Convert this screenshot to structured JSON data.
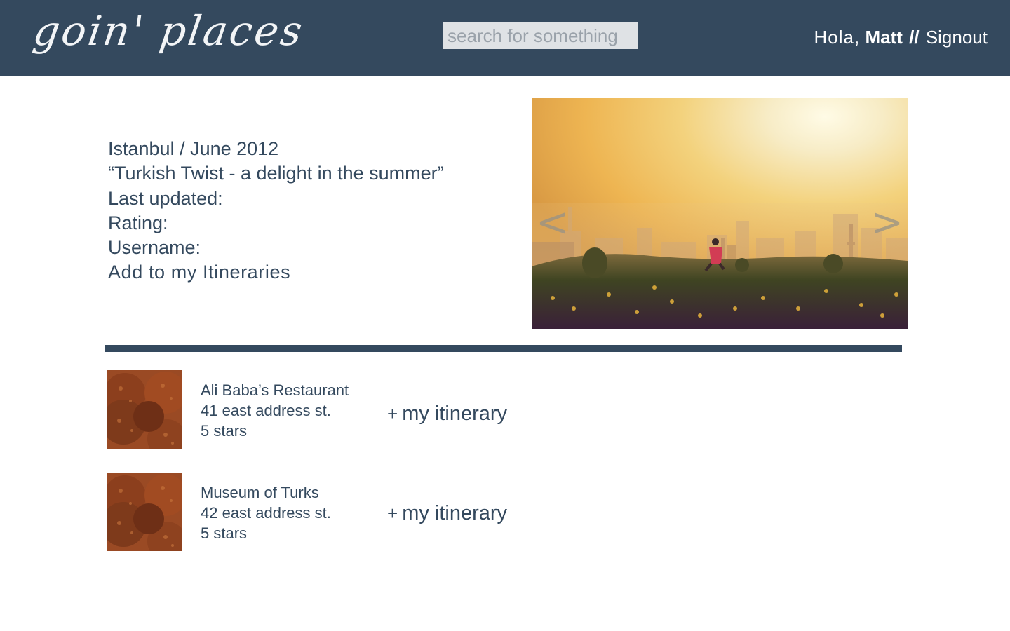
{
  "header": {
    "logo": "goin' places",
    "search_placeholder": "search for something",
    "greeting": "Hola,",
    "username": "Matt",
    "separator": "//",
    "signout_label": "Signout"
  },
  "trip": {
    "location_date": "Istanbul / June 2012",
    "title": "“Turkish Twist - a delight in the summer”",
    "last_updated_label": "Last updated:",
    "rating_label": "Rating:",
    "username_label": "Username:",
    "add_link": "Add to my Itineraries"
  },
  "carousel": {
    "prev_label": "<",
    "next_label": ">"
  },
  "places": [
    {
      "name": "Ali Baba’s Restaurant",
      "address": "41 east address st.",
      "rating": "5 stars",
      "add_plus": "+",
      "add_label": "my itinerary"
    },
    {
      "name": "Museum of Turks",
      "address": "42 east address st.",
      "rating": "5 stars",
      "add_plus": "+",
      "add_label": "my itinerary"
    }
  ],
  "colors": {
    "header_bg": "#34495e",
    "text": "#34495e",
    "search_bg": "#dfe2e5",
    "divider": "#34495e"
  }
}
